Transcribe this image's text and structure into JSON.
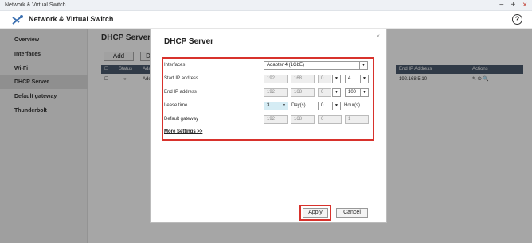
{
  "window": {
    "title": "Network & Virtual Switch",
    "controls": [
      "−",
      "+",
      "×"
    ]
  },
  "app": {
    "name": "Network & Virtual Switch",
    "help": "?"
  },
  "sidebar": {
    "items": [
      {
        "label": "Overview"
      },
      {
        "label": "Interfaces"
      },
      {
        "label": "Wi-Fi"
      },
      {
        "label": "DHCP Server",
        "active": true
      },
      {
        "label": "Default gateway"
      },
      {
        "label": "Thunderbolt"
      }
    ]
  },
  "background": {
    "title": "DHCP Server In",
    "add_label": "Add",
    "d_label": "D",
    "table": {
      "headers": {
        "status": "Status",
        "adapter": "Ada",
        "end_ip": "End IP Address",
        "actions": "Actions"
      },
      "row": {
        "status": "○",
        "adapter": "Ade",
        "end_ip": "192.168.5.10",
        "actions": "✎ ⏻ 🔍"
      }
    }
  },
  "dialog": {
    "title": "DHCP Server",
    "close": "×",
    "interfaces_label": "Interfaces",
    "interfaces_value": "Adapter 4 (1GbE)",
    "start_ip_label": "Start IP address",
    "start_ip": [
      "192",
      "168",
      "0",
      "4"
    ],
    "end_ip_label": "End IP address",
    "end_ip": [
      "192",
      "168",
      "0",
      "100"
    ],
    "lease_label": "Lease time",
    "lease_days": "3",
    "days_unit": "Day(s)",
    "lease_hours": "0",
    "hours_unit": "Hour(s)",
    "gateway_label": "Default gateway",
    "gateway": [
      "192",
      "168",
      "0",
      "1"
    ],
    "more_settings": "More Settings >>",
    "apply_label": "Apply",
    "cancel_label": "Cancel"
  },
  "colors": {
    "highlight": "#d8322c",
    "table_header": "#4a5a6e"
  }
}
